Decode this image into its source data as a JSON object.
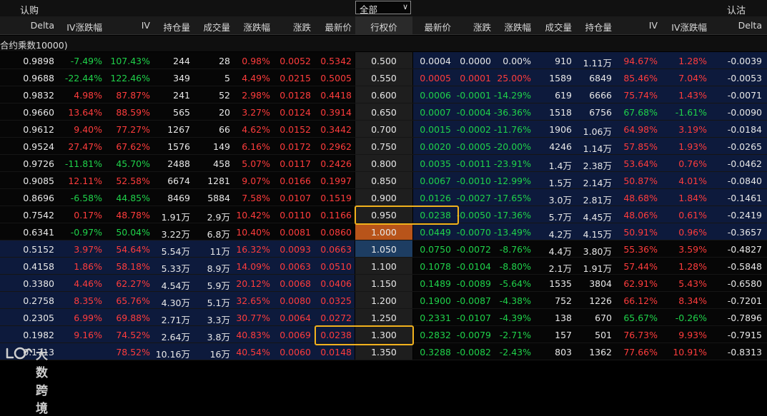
{
  "header": {
    "call_label": "认购",
    "put_label": "认沽",
    "filter_value": "全部",
    "strike_header": "行权价",
    "call_columns": [
      "Delta",
      "IV涨跌幅",
      "IV",
      "持仓量",
      "成交量",
      "涨跌幅",
      "涨跌",
      "最新价"
    ],
    "put_columns": [
      "最新价",
      "涨跌",
      "涨跌幅",
      "成交量",
      "持仓量",
      "IV",
      "IV涨跌幅",
      "Delta"
    ],
    "subheader": "合约乘数10000)"
  },
  "colors": {
    "up": "#ff3c3c",
    "down": "#1fd24a",
    "neutral": "#e8e8e8",
    "itm_bg": "#0d1a3c",
    "atm_bg": "#b8541a",
    "highlight_box": "#f2b21d"
  },
  "watermark": "大数跨境",
  "rows": [
    {
      "call": [
        [
          "0.9898",
          "w"
        ],
        [
          "-7.49%",
          "g"
        ],
        [
          "107.43%",
          "g"
        ],
        [
          "244",
          "w"
        ],
        [
          "28",
          "w"
        ],
        [
          "0.98%",
          "r"
        ],
        [
          "0.0052",
          "r"
        ],
        [
          "0.5342",
          "r"
        ]
      ],
      "strike": "0.500",
      "put": [
        [
          "0.0004",
          "w"
        ],
        [
          "0.0000",
          "w"
        ],
        [
          "0.00%",
          "w"
        ],
        [
          "910",
          "w"
        ],
        [
          "1.11万",
          "w"
        ],
        [
          "94.67%",
          "r"
        ],
        [
          "1.28%",
          "r"
        ],
        [
          "-0.0039",
          "w"
        ]
      ]
    },
    {
      "call": [
        [
          "0.9688",
          "w"
        ],
        [
          "-22.44%",
          "g"
        ],
        [
          "122.46%",
          "g"
        ],
        [
          "349",
          "w"
        ],
        [
          "5",
          "w"
        ],
        [
          "4.49%",
          "r"
        ],
        [
          "0.0215",
          "r"
        ],
        [
          "0.5005",
          "r"
        ]
      ],
      "strike": "0.550",
      "put": [
        [
          "0.0005",
          "r"
        ],
        [
          "0.0001",
          "r"
        ],
        [
          "25.00%",
          "r"
        ],
        [
          "1589",
          "w"
        ],
        [
          "6849",
          "w"
        ],
        [
          "85.46%",
          "r"
        ],
        [
          "7.04%",
          "r"
        ],
        [
          "-0.0053",
          "w"
        ]
      ]
    },
    {
      "call": [
        [
          "0.9832",
          "w"
        ],
        [
          "4.98%",
          "r"
        ],
        [
          "87.87%",
          "r"
        ],
        [
          "241",
          "w"
        ],
        [
          "52",
          "w"
        ],
        [
          "2.98%",
          "r"
        ],
        [
          "0.0128",
          "r"
        ],
        [
          "0.4418",
          "r"
        ]
      ],
      "strike": "0.600",
      "put": [
        [
          "0.0006",
          "g"
        ],
        [
          "-0.0001",
          "g"
        ],
        [
          "-14.29%",
          "g"
        ],
        [
          "619",
          "w"
        ],
        [
          "6666",
          "w"
        ],
        [
          "75.74%",
          "r"
        ],
        [
          "1.43%",
          "r"
        ],
        [
          "-0.0071",
          "w"
        ]
      ]
    },
    {
      "call": [
        [
          "0.9660",
          "w"
        ],
        [
          "13.64%",
          "r"
        ],
        [
          "88.59%",
          "r"
        ],
        [
          "565",
          "w"
        ],
        [
          "20",
          "w"
        ],
        [
          "3.27%",
          "r"
        ],
        [
          "0.0124",
          "r"
        ],
        [
          "0.3914",
          "r"
        ]
      ],
      "strike": "0.650",
      "put": [
        [
          "0.0007",
          "g"
        ],
        [
          "-0.0004",
          "g"
        ],
        [
          "-36.36%",
          "g"
        ],
        [
          "1518",
          "w"
        ],
        [
          "6756",
          "w"
        ],
        [
          "67.68%",
          "g"
        ],
        [
          "-1.61%",
          "g"
        ],
        [
          "-0.0090",
          "w"
        ]
      ]
    },
    {
      "call": [
        [
          "0.9612",
          "w"
        ],
        [
          "9.40%",
          "r"
        ],
        [
          "77.27%",
          "r"
        ],
        [
          "1267",
          "w"
        ],
        [
          "66",
          "w"
        ],
        [
          "4.62%",
          "r"
        ],
        [
          "0.0152",
          "r"
        ],
        [
          "0.3442",
          "r"
        ]
      ],
      "strike": "0.700",
      "put": [
        [
          "0.0015",
          "g"
        ],
        [
          "-0.0002",
          "g"
        ],
        [
          "-11.76%",
          "g"
        ],
        [
          "1906",
          "w"
        ],
        [
          "1.06万",
          "w"
        ],
        [
          "64.98%",
          "r"
        ],
        [
          "3.19%",
          "r"
        ],
        [
          "-0.0184",
          "w"
        ]
      ]
    },
    {
      "call": [
        [
          "0.9524",
          "w"
        ],
        [
          "27.47%",
          "r"
        ],
        [
          "67.62%",
          "r"
        ],
        [
          "1576",
          "w"
        ],
        [
          "149",
          "w"
        ],
        [
          "6.16%",
          "r"
        ],
        [
          "0.0172",
          "r"
        ],
        [
          "0.2962",
          "r"
        ]
      ],
      "strike": "0.750",
      "put": [
        [
          "0.0020",
          "g"
        ],
        [
          "-0.0005",
          "g"
        ],
        [
          "-20.00%",
          "g"
        ],
        [
          "4246",
          "w"
        ],
        [
          "1.14万",
          "w"
        ],
        [
          "57.85%",
          "r"
        ],
        [
          "1.93%",
          "r"
        ],
        [
          "-0.0265",
          "w"
        ]
      ]
    },
    {
      "call": [
        [
          "0.9726",
          "w"
        ],
        [
          "-11.81%",
          "g"
        ],
        [
          "45.70%",
          "g"
        ],
        [
          "2488",
          "w"
        ],
        [
          "458",
          "w"
        ],
        [
          "5.07%",
          "r"
        ],
        [
          "0.0117",
          "r"
        ],
        [
          "0.2426",
          "r"
        ]
      ],
      "strike": "0.800",
      "put": [
        [
          "0.0035",
          "g"
        ],
        [
          "-0.0011",
          "g"
        ],
        [
          "-23.91%",
          "g"
        ],
        [
          "1.4万",
          "w"
        ],
        [
          "2.38万",
          "w"
        ],
        [
          "53.64%",
          "r"
        ],
        [
          "0.76%",
          "r"
        ],
        [
          "-0.0462",
          "w"
        ]
      ]
    },
    {
      "call": [
        [
          "0.9085",
          "w"
        ],
        [
          "12.11%",
          "r"
        ],
        [
          "52.58%",
          "r"
        ],
        [
          "6674",
          "w"
        ],
        [
          "1281",
          "w"
        ],
        [
          "9.07%",
          "r"
        ],
        [
          "0.0166",
          "r"
        ],
        [
          "0.1997",
          "r"
        ]
      ],
      "strike": "0.850",
      "put": [
        [
          "0.0067",
          "g"
        ],
        [
          "-0.0010",
          "g"
        ],
        [
          "-12.99%",
          "g"
        ],
        [
          "1.5万",
          "w"
        ],
        [
          "2.14万",
          "w"
        ],
        [
          "50.87%",
          "r"
        ],
        [
          "4.01%",
          "r"
        ],
        [
          "-0.0840",
          "w"
        ]
      ]
    },
    {
      "call": [
        [
          "0.8696",
          "w"
        ],
        [
          "-6.58%",
          "g"
        ],
        [
          "44.85%",
          "g"
        ],
        [
          "8469",
          "w"
        ],
        [
          "5884",
          "w"
        ],
        [
          "7.58%",
          "r"
        ],
        [
          "0.0107",
          "r"
        ],
        [
          "0.1519",
          "r"
        ]
      ],
      "strike": "0.900",
      "put": [
        [
          "0.0126",
          "g"
        ],
        [
          "-0.0027",
          "g"
        ],
        [
          "-17.65%",
          "g"
        ],
        [
          "3.0万",
          "w"
        ],
        [
          "2.81万",
          "w"
        ],
        [
          "48.68%",
          "r"
        ],
        [
          "1.84%",
          "r"
        ],
        [
          "-0.1461",
          "w"
        ]
      ]
    },
    {
      "call": [
        [
          "0.7542",
          "w"
        ],
        [
          "0.17%",
          "r"
        ],
        [
          "48.78%",
          "r"
        ],
        [
          "1.91万",
          "w"
        ],
        [
          "2.9万",
          "w"
        ],
        [
          "10.42%",
          "r"
        ],
        [
          "0.0110",
          "r"
        ],
        [
          "0.1166",
          "r"
        ]
      ],
      "strike": "0.950",
      "put": [
        [
          "0.0238",
          "g"
        ],
        [
          "-0.0050",
          "g"
        ],
        [
          "-17.36%",
          "g"
        ],
        [
          "5.7万",
          "w"
        ],
        [
          "4.45万",
          "w"
        ],
        [
          "48.06%",
          "r"
        ],
        [
          "0.61%",
          "r"
        ],
        [
          "-0.2419",
          "w"
        ]
      ]
    },
    {
      "call": [
        [
          "0.6341",
          "w"
        ],
        [
          "-0.97%",
          "g"
        ],
        [
          "50.04%",
          "g"
        ],
        [
          "3.22万",
          "w"
        ],
        [
          "6.8万",
          "w"
        ],
        [
          "10.40%",
          "r"
        ],
        [
          "0.0081",
          "r"
        ],
        [
          "0.0860",
          "r"
        ]
      ],
      "strike": "1.000",
      "put": [
        [
          "0.0449",
          "g"
        ],
        [
          "-0.0070",
          "g"
        ],
        [
          "-13.49%",
          "g"
        ],
        [
          "4.2万",
          "w"
        ],
        [
          "4.15万",
          "w"
        ],
        [
          "50.91%",
          "r"
        ],
        [
          "0.96%",
          "r"
        ],
        [
          "-0.3657",
          "w"
        ]
      ]
    },
    {
      "call": [
        [
          "0.5152",
          "w"
        ],
        [
          "3.97%",
          "r"
        ],
        [
          "54.64%",
          "r"
        ],
        [
          "5.54万",
          "w"
        ],
        [
          "11万",
          "w"
        ],
        [
          "16.32%",
          "r"
        ],
        [
          "0.0093",
          "r"
        ],
        [
          "0.0663",
          "r"
        ]
      ],
      "strike": "1.050",
      "put": [
        [
          "0.0750",
          "g"
        ],
        [
          "-0.0072",
          "g"
        ],
        [
          "-8.76%",
          "g"
        ],
        [
          "4.4万",
          "w"
        ],
        [
          "3.80万",
          "w"
        ],
        [
          "55.36%",
          "r"
        ],
        [
          "3.59%",
          "r"
        ],
        [
          "-0.4827",
          "w"
        ]
      ]
    },
    {
      "call": [
        [
          "0.4158",
          "w"
        ],
        [
          "1.86%",
          "r"
        ],
        [
          "58.18%",
          "r"
        ],
        [
          "5.33万",
          "w"
        ],
        [
          "8.9万",
          "w"
        ],
        [
          "14.09%",
          "r"
        ],
        [
          "0.0063",
          "r"
        ],
        [
          "0.0510",
          "r"
        ]
      ],
      "strike": "1.100",
      "put": [
        [
          "0.1078",
          "g"
        ],
        [
          "-0.0104",
          "g"
        ],
        [
          "-8.80%",
          "g"
        ],
        [
          "2.1万",
          "w"
        ],
        [
          "1.91万",
          "w"
        ],
        [
          "57.44%",
          "r"
        ],
        [
          "1.28%",
          "r"
        ],
        [
          "-0.5848",
          "w"
        ]
      ]
    },
    {
      "call": [
        [
          "0.3380",
          "w"
        ],
        [
          "4.46%",
          "r"
        ],
        [
          "62.27%",
          "r"
        ],
        [
          "4.54万",
          "w"
        ],
        [
          "5.9万",
          "w"
        ],
        [
          "20.12%",
          "r"
        ],
        [
          "0.0068",
          "r"
        ],
        [
          "0.0406",
          "r"
        ]
      ],
      "strike": "1.150",
      "put": [
        [
          "0.1489",
          "g"
        ],
        [
          "-0.0089",
          "g"
        ],
        [
          "-5.64%",
          "g"
        ],
        [
          "1535",
          "w"
        ],
        [
          "3804",
          "w"
        ],
        [
          "62.91%",
          "r"
        ],
        [
          "5.43%",
          "r"
        ],
        [
          "-0.6580",
          "w"
        ]
      ]
    },
    {
      "call": [
        [
          "0.2758",
          "w"
        ],
        [
          "8.35%",
          "r"
        ],
        [
          "65.76%",
          "r"
        ],
        [
          "4.30万",
          "w"
        ],
        [
          "5.1万",
          "w"
        ],
        [
          "32.65%",
          "r"
        ],
        [
          "0.0080",
          "r"
        ],
        [
          "0.0325",
          "r"
        ]
      ],
      "strike": "1.200",
      "put": [
        [
          "0.1900",
          "g"
        ],
        [
          "-0.0087",
          "g"
        ],
        [
          "-4.38%",
          "g"
        ],
        [
          "752",
          "w"
        ],
        [
          "1226",
          "w"
        ],
        [
          "66.12%",
          "r"
        ],
        [
          "8.34%",
          "r"
        ],
        [
          "-0.7201",
          "w"
        ]
      ]
    },
    {
      "call": [
        [
          "0.2305",
          "w"
        ],
        [
          "6.99%",
          "r"
        ],
        [
          "69.88%",
          "r"
        ],
        [
          "2.71万",
          "w"
        ],
        [
          "3.3万",
          "w"
        ],
        [
          "30.77%",
          "r"
        ],
        [
          "0.0064",
          "r"
        ],
        [
          "0.0272",
          "r"
        ]
      ],
      "strike": "1.250",
      "put": [
        [
          "0.2331",
          "g"
        ],
        [
          "-0.0107",
          "g"
        ],
        [
          "-4.39%",
          "g"
        ],
        [
          "138",
          "w"
        ],
        [
          "670",
          "w"
        ],
        [
          "65.67%",
          "g"
        ],
        [
          "-0.26%",
          "g"
        ],
        [
          "-0.7896",
          "w"
        ]
      ]
    },
    {
      "call": [
        [
          "0.1982",
          "w"
        ],
        [
          "9.16%",
          "r"
        ],
        [
          "74.52%",
          "r"
        ],
        [
          "2.64万",
          "w"
        ],
        [
          "3.8万",
          "w"
        ],
        [
          "40.83%",
          "r"
        ],
        [
          "0.0069",
          "r"
        ],
        [
          "0.0238",
          "r"
        ]
      ],
      "strike": "1.300",
      "put": [
        [
          "0.2832",
          "g"
        ],
        [
          "-0.0079",
          "g"
        ],
        [
          "-2.71%",
          "g"
        ],
        [
          "157",
          "w"
        ],
        [
          "501",
          "w"
        ],
        [
          "76.73%",
          "r"
        ],
        [
          "9.93%",
          "r"
        ],
        [
          "-0.7915",
          "w"
        ]
      ]
    },
    {
      "call": [
        [
          "0.1713",
          "w"
        ],
        [
          "",
          "r"
        ],
        [
          "78.52%",
          "r"
        ],
        [
          "10.16万",
          "w"
        ],
        [
          "16万",
          "w"
        ],
        [
          "40.54%",
          "r"
        ],
        [
          "0.0060",
          "r"
        ],
        [
          "0.0148",
          "r"
        ]
      ],
      "strike": "1.350",
      "put": [
        [
          "0.3288",
          "g"
        ],
        [
          "-0.0082",
          "g"
        ],
        [
          "-2.43%",
          "g"
        ],
        [
          "803",
          "w"
        ],
        [
          "1362",
          "w"
        ],
        [
          "77.66%",
          "r"
        ],
        [
          "10.91%",
          "r"
        ],
        [
          "-0.8313",
          "w"
        ]
      ]
    }
  ]
}
